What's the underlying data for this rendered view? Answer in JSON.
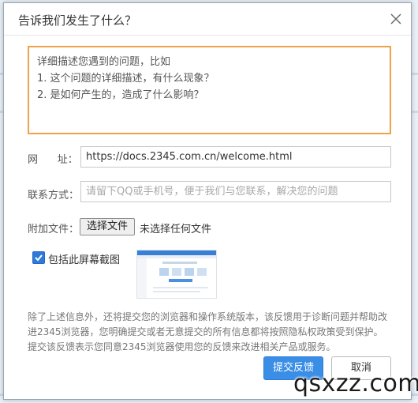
{
  "dialog": {
    "title": "告诉我们发生了什么？",
    "close_icon": "close-icon"
  },
  "description": {
    "placeholder_text": "详细描述您遇到的问题，比如\n1. 这个问题的详细描述，有什么现象？\n2. 是如何产生的，造成了什么影响？"
  },
  "url_row": {
    "label": "网      址：",
    "value": "https://docs.2345.com.cn/welcome.html"
  },
  "contact_row": {
    "label": "联系方式：",
    "placeholder": "请留下QQ或手机号，便于我们与您联系，解决您的问题"
  },
  "attachment_row": {
    "label": "附加文件：",
    "choose_button": "选择文件",
    "status": "未选择任何文件"
  },
  "screenshot": {
    "checked": true,
    "label": "包括此屏幕截图"
  },
  "notice": "除了上述信息外，还将提交您的浏览器和操作系统版本，该反馈用于诊断问题并帮助改进2345浏览器，您明确提交或者无意提交的所有信息都将按照隐私权政策受到保护。提交该反馈表示您同意2345浏览器使用您的反馈来改进相关产品或服务。",
  "buttons": {
    "submit": "提交反馈",
    "cancel": "取消"
  },
  "watermark": "qsxzz.com",
  "colors": {
    "accent": "#3a8ee6",
    "focus_border": "#f0a24a"
  }
}
